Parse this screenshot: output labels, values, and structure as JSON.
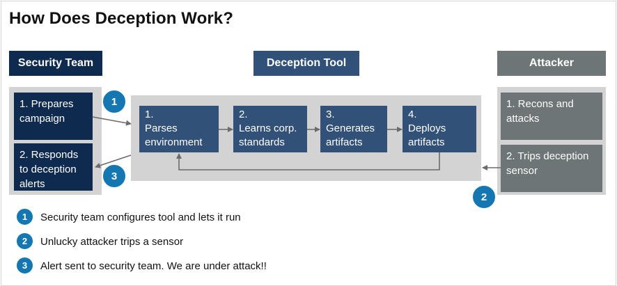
{
  "title": "How Does Deception Work?",
  "columns": {
    "security": {
      "header": "Security Team",
      "steps": [
        "1. Prepares campaign",
        "2. Responds to deception alerts"
      ]
    },
    "tool": {
      "header": "Deception Tool",
      "steps": [
        "1.\nParses environment",
        "2.\nLearns corp. standards",
        "3.\nGenerates artifacts",
        "4.\nDeploys artifacts"
      ]
    },
    "attacker": {
      "header": "Attacker",
      "steps": [
        "1. Recons and attacks",
        "2. Trips deception sensor"
      ]
    }
  },
  "markers": [
    "1",
    "3",
    "2"
  ],
  "legend": [
    {
      "num": "1",
      "text": "Security team configures tool and lets it run"
    },
    {
      "num": "2",
      "text": "Unlucky attacker trips a sensor"
    },
    {
      "num": "3",
      "text": "Alert sent to security team. We are under attack!!"
    }
  ],
  "colors": {
    "navy": "#0e2a4f",
    "steel": "#325178",
    "gray": "#6d7576",
    "panel": "#d3d3d3",
    "marker": "#1577b1"
  }
}
